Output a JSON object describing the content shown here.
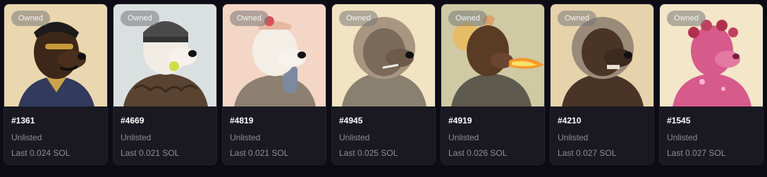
{
  "cards": [
    {
      "badge": "Owned",
      "name": "#1361",
      "status": "Unlisted",
      "last": "Last 0.024 SOL",
      "bg": "#ead7b0",
      "fur": "#3d2718",
      "accent": "#323a5e"
    },
    {
      "badge": "Owned",
      "name": "#4669",
      "status": "Unlisted",
      "last": "Last 0.021 SOL",
      "bg": "#dadfe0",
      "fur": "#f1ede4",
      "accent": "#5a4330"
    },
    {
      "badge": "Owned",
      "name": "#4819",
      "status": "Unlisted",
      "last": "Last 0.021 SOL",
      "bg": "#f4d6c6",
      "fur": "#f3eee6",
      "accent": "#8d8071"
    },
    {
      "badge": "Owned",
      "name": "#4945",
      "status": "Unlisted",
      "last": "Last 0.025 SOL",
      "bg": "#f2e3c2",
      "fur": "#7b6a58",
      "accent": "#8a8070"
    },
    {
      "badge": "Owned",
      "name": "#4919",
      "status": "Unlisted",
      "last": "Last 0.026 SOL",
      "bg": "#cfc9a4",
      "fur": "#5a3b24",
      "accent": "#f29a2a"
    },
    {
      "badge": "Owned",
      "name": "#4210",
      "status": "Unlisted",
      "last": "Last 0.027 SOL",
      "bg": "#e6d3ab",
      "fur": "#4a3426",
      "accent": "#9a8a78"
    },
    {
      "badge": "Owned",
      "name": "#1545",
      "status": "Unlisted",
      "last": "Last 0.027 SOL",
      "bg": "#f3e6c9",
      "fur": "#d65a8a",
      "accent": "#b0314d"
    }
  ]
}
